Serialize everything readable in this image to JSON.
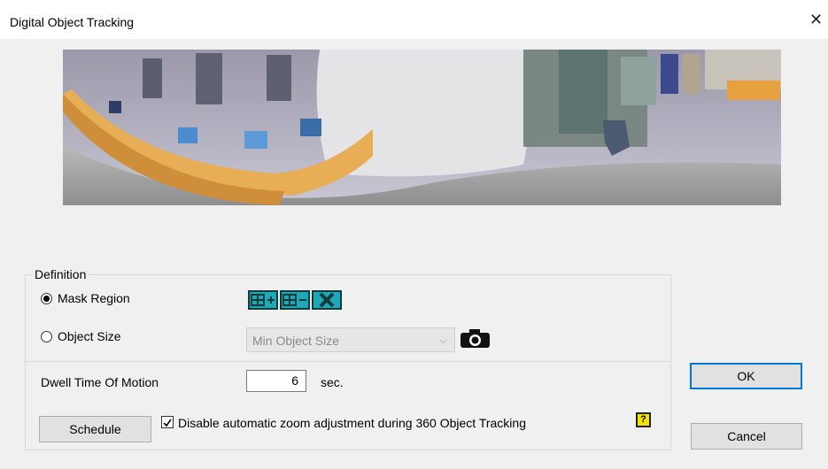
{
  "window": {
    "title": "Digital Object Tracking",
    "close_symbol": "✕"
  },
  "definition": {
    "legend": "Definition",
    "mask_region_label": "Mask Region",
    "mask_region_selected": true,
    "mask_tools": [
      "add-region-icon",
      "remove-region-icon",
      "clear-region-icon"
    ],
    "object_size_label": "Object Size",
    "object_size_selected": false,
    "object_size_select_value": "Min Object Size",
    "camera_icon": "camera-icon"
  },
  "dwell": {
    "label": "Dwell Time Of Motion",
    "value": "6",
    "unit": "sec."
  },
  "schedule_label": "Schedule",
  "disable_zoom": {
    "label": "Disable automatic zoom adjustment during 360 Object Tracking",
    "checked": true
  },
  "help_icon_symbol": "?",
  "ok_label": "OK",
  "cancel_label": "Cancel"
}
